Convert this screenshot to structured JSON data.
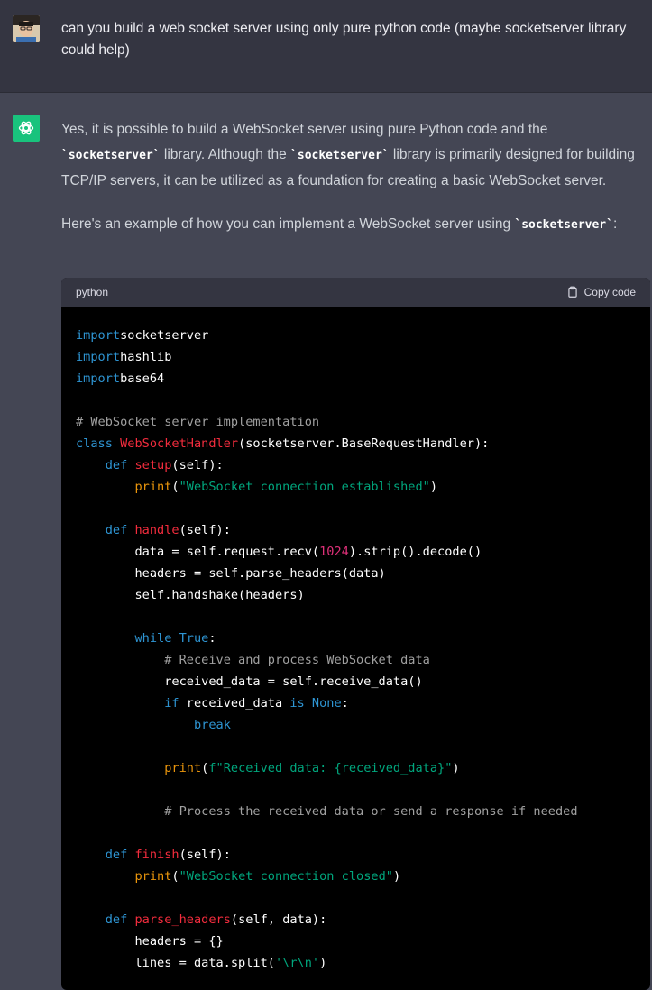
{
  "user_message": {
    "text": "can you build a web socket server using only pure python code (maybe socketserver library could help)"
  },
  "assistant_message": {
    "p1_a": "Yes, it is possible to build a WebSocket server using pure Python code and the ",
    "p1_code1": "`socketserver`",
    "p1_b": " library. Although the ",
    "p1_code2": "`socketserver`",
    "p1_c": " library is primarily designed for building TCP/IP servers, it can be utilized as a foundation for creating a basic WebSocket server.",
    "p2_a": "Here's an example of how you can implement a WebSocket server using ",
    "p2_code": "`socketserver`",
    "p2_b": ":"
  },
  "code_block": {
    "language": "python",
    "copy_label": "Copy code",
    "lines": [
      [
        [
          "kw",
          "import"
        ],
        [
          "",
          "socketserver"
        ]
      ],
      [
        [
          "kw",
          "import"
        ],
        [
          "",
          "hashlib"
        ]
      ],
      [
        [
          "kw",
          "import"
        ],
        [
          "",
          "base64"
        ]
      ],
      [],
      [
        [
          "cm",
          "# WebSocket server implementation"
        ]
      ],
      [
        [
          "kw",
          "class "
        ],
        [
          "fn",
          "WebSocketHandler"
        ],
        [
          "",
          "(socketserver.BaseRequestHandler):"
        ]
      ],
      [
        [
          "",
          "    "
        ],
        [
          "kw",
          "def "
        ],
        [
          "fn",
          "setup"
        ],
        [
          "",
          "(self):"
        ]
      ],
      [
        [
          "",
          "        "
        ],
        [
          "bi",
          "print"
        ],
        [
          "",
          "("
        ],
        [
          "str",
          "\"WebSocket connection established\""
        ],
        [
          "",
          ")"
        ]
      ],
      [],
      [
        [
          "",
          "    "
        ],
        [
          "kw",
          "def "
        ],
        [
          "fn",
          "handle"
        ],
        [
          "",
          "(self):"
        ]
      ],
      [
        [
          "",
          "        data = self.request.recv("
        ],
        [
          "num",
          "1024"
        ],
        [
          "",
          ").strip().decode()"
        ]
      ],
      [
        [
          "",
          "        headers = self.parse_headers(data)"
        ]
      ],
      [
        [
          "",
          "        self.handshake(headers)"
        ]
      ],
      [],
      [
        [
          "",
          "        "
        ],
        [
          "kw",
          "while "
        ],
        [
          "kw",
          "True"
        ],
        [
          "",
          ":"
        ]
      ],
      [
        [
          "",
          "            "
        ],
        [
          "cm",
          "# Receive and process WebSocket data"
        ]
      ],
      [
        [
          "",
          "            received_data = self.receive_data()"
        ]
      ],
      [
        [
          "",
          "            "
        ],
        [
          "kw",
          "if "
        ],
        [
          "",
          "received_data "
        ],
        [
          "kw",
          "is "
        ],
        [
          "kw",
          "None"
        ],
        [
          "",
          ":"
        ]
      ],
      [
        [
          "",
          "                "
        ],
        [
          "kw",
          "break"
        ]
      ],
      [],
      [
        [
          "",
          "            "
        ],
        [
          "bi",
          "print"
        ],
        [
          "",
          "("
        ],
        [
          "str",
          "f\"Received data: {received_data}\""
        ],
        [
          "",
          ")"
        ]
      ],
      [],
      [
        [
          "",
          "            "
        ],
        [
          "cm",
          "# Process the received data or send a response if needed"
        ]
      ],
      [],
      [
        [
          "",
          "    "
        ],
        [
          "kw",
          "def "
        ],
        [
          "fn",
          "finish"
        ],
        [
          "",
          "(self):"
        ]
      ],
      [
        [
          "",
          "        "
        ],
        [
          "bi",
          "print"
        ],
        [
          "",
          "("
        ],
        [
          "str",
          "\"WebSocket connection closed\""
        ],
        [
          "",
          ")"
        ]
      ],
      [],
      [
        [
          "",
          "    "
        ],
        [
          "kw",
          "def "
        ],
        [
          "fn",
          "parse_headers"
        ],
        [
          "",
          "(self, data):"
        ]
      ],
      [
        [
          "",
          "        headers = {}"
        ]
      ],
      [
        [
          "",
          "        lines = data.split("
        ],
        [
          "str",
          "'\\r\\n'"
        ],
        [
          "",
          ")"
        ]
      ]
    ]
  },
  "colors": {
    "user_bg": "#343541",
    "assistant_bg": "#444654",
    "code_bg": "#000000",
    "accent": "#19c37d"
  },
  "icons": {
    "avatar": "user-avatar",
    "logo": "openai-logo-icon",
    "copy": "clipboard-icon"
  }
}
